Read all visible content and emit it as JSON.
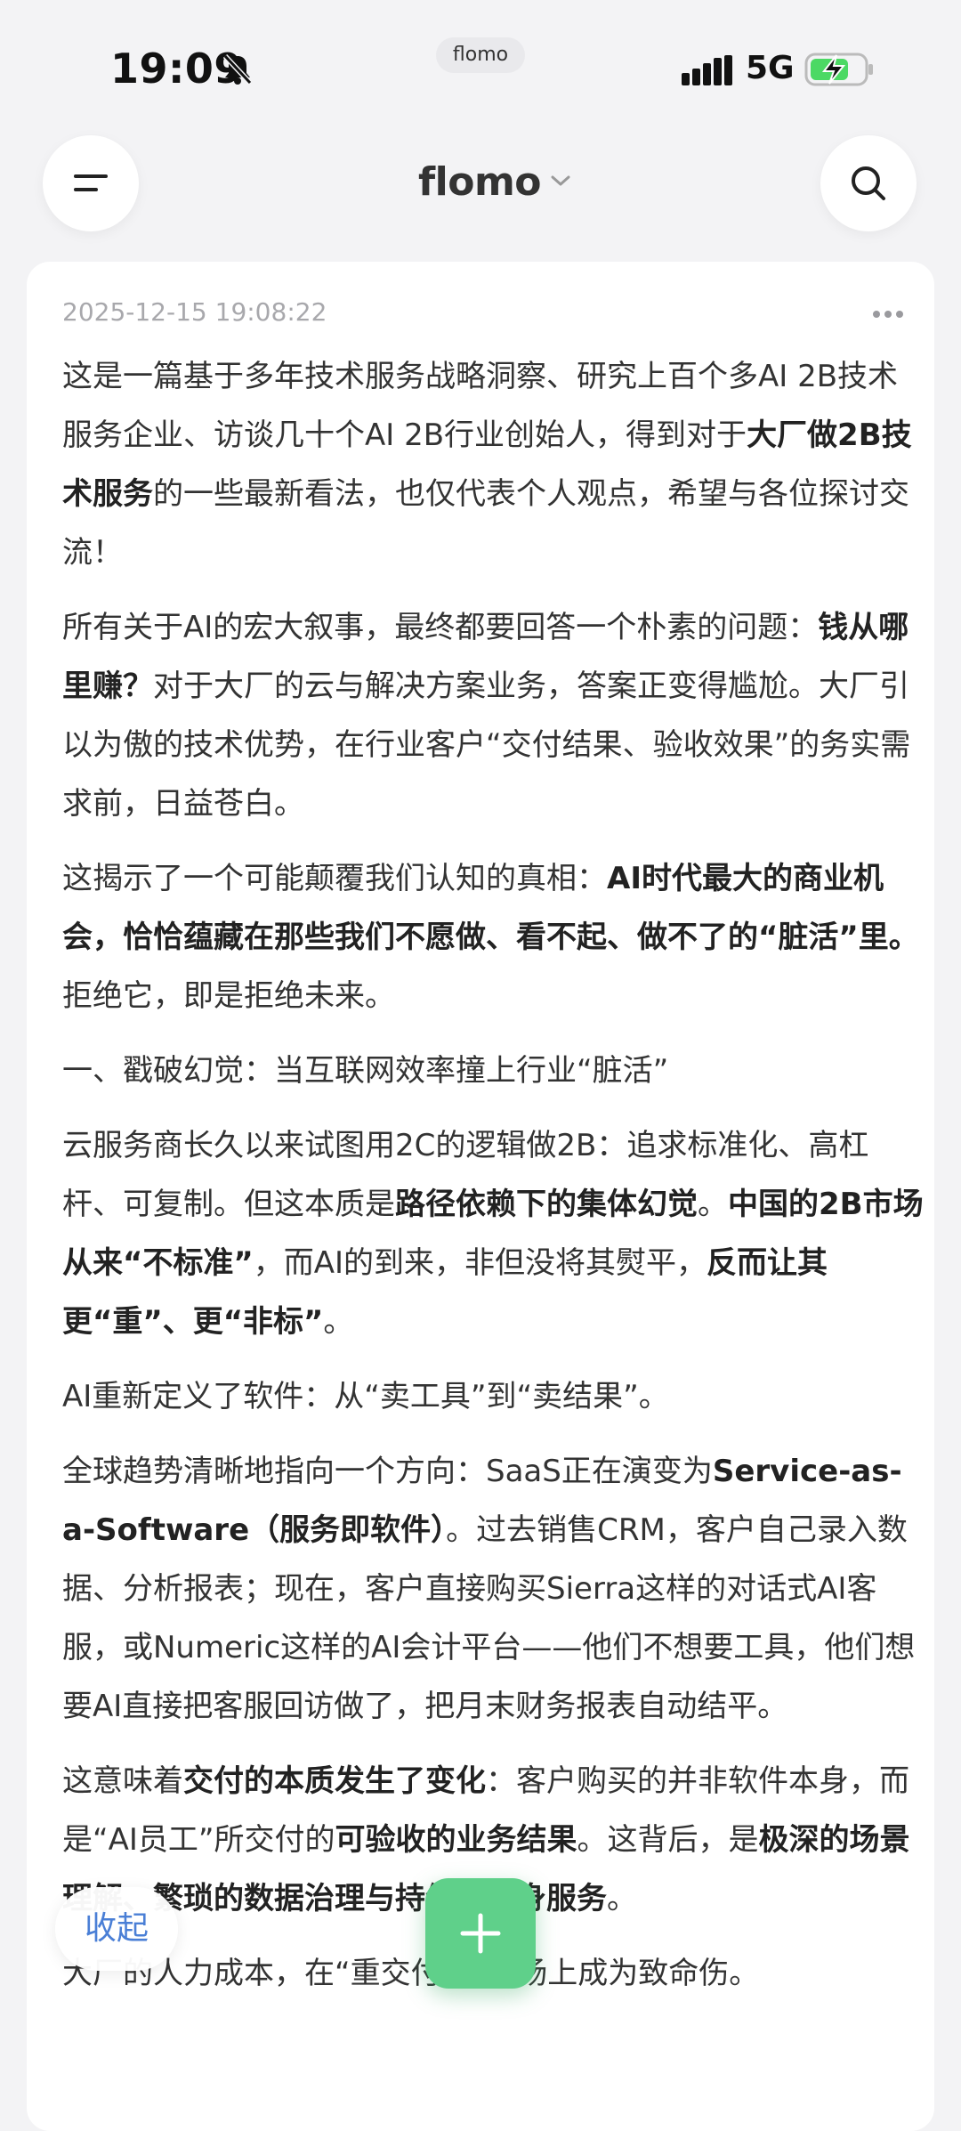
{
  "status_bar": {
    "time": "19:09",
    "island_label": "flomo",
    "network": "5G",
    "icons": [
      "bell-slash-icon",
      "signal-icon",
      "battery-charging-icon"
    ]
  },
  "header": {
    "app_name": "flomo",
    "icons": [
      "menu-icon",
      "chevron-down-icon",
      "search-icon"
    ]
  },
  "memo": {
    "timestamp": "2025-12-15 19:08:22",
    "more_icon": "more-dots-icon",
    "paragraphs": [
      [
        {
          "t": "这是一篇基于多年技术服务战略洞察、研究上百个多AI 2B技术服务企业、访谈几十个AI 2B行业创始人，得到对于"
        },
        {
          "t": "大厂做2B技术服务",
          "b": true
        },
        {
          "t": "的一些最新看法，也仅代表个人观点，希望与各位探讨交流！"
        }
      ],
      [
        {
          "t": "所有关于AI的宏大叙事，最终都要回答一个朴素的问题："
        },
        {
          "t": "钱从哪里赚？",
          "b": true
        },
        {
          "t": "对于大厂的云与解决方案业务，答案正变得尴尬。大厂引以为傲的技术优势，在行业客户“交付结果、验收效果”的务实需求前，日益苍白。"
        }
      ],
      [
        {
          "t": "这揭示了一个可能颠覆我们认知的真相："
        },
        {
          "t": "AI时代最大的商业机会，恰恰蕴藏在那些我们不愿做、看不起、做不了的“脏活”里。",
          "b": true
        },
        {
          "t": "拒绝它，即是拒绝未来。"
        }
      ],
      [
        {
          "t": "一、戳破幻觉：当互联网效率撞上行业“脏活”"
        }
      ],
      [
        {
          "t": "云服务商长久以来试图用2C的逻辑做2B：追求标准化、高杠杆、可复制。但这本质是"
        },
        {
          "t": "路径依赖下的集体幻觉",
          "b": true
        },
        {
          "t": "。"
        },
        {
          "t": "中国的2B市场从来“不标准”",
          "b": true
        },
        {
          "t": "，而AI的到来，非但没将其熨平，"
        },
        {
          "t": "反而让其更“重”、更“非标”",
          "b": true
        },
        {
          "t": "。"
        }
      ],
      [
        {
          "t": "AI重新定义了软件：从“卖工具”到“卖结果”。"
        }
      ],
      [
        {
          "t": "全球趋势清晰地指向一个方向：SaaS正在演变为"
        },
        {
          "t": "Service-as-a-Software（服务即软件）",
          "b": true
        },
        {
          "t": "。过去销售CRM，客户自己录入数据、分析报表；现在，客户直接购买Sierra这样的对话式AI客服，或Numeric这样的AI会计平台——他们不想要工具，他们想要AI直接把客服回访做了，把月末财务报表自动结平。"
        }
      ],
      [
        {
          "t": "这意味着"
        },
        {
          "t": "交付的本质发生了变化",
          "b": true
        },
        {
          "t": "：客户购买的并非软件本身，而是“AI员工”所交付的"
        },
        {
          "t": "可验收的业务结果",
          "b": true
        },
        {
          "t": "。这背后，是"
        },
        {
          "t": "极深的场景理解、繁琐的数据治理与持续的贴身服务",
          "b": true
        },
        {
          "t": "。"
        }
      ],
      [
        {
          "t": "大厂的人力成本，在“重交付”的战场上成为致命伤。"
        }
      ]
    ]
  },
  "floating": {
    "collapse_label": "收起",
    "add_icon": "plus-icon",
    "add_color": "#5fd08a"
  }
}
